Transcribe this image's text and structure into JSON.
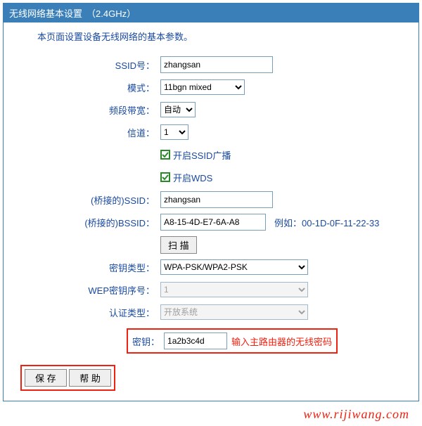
{
  "header": {
    "title": "无线网络基本设置",
    "band": "（2.4GHz）"
  },
  "desc": "本页面设置设备无线网络的基本参数。",
  "labels": {
    "ssid": "SSID号：",
    "mode": "模式：",
    "bw": "频段带宽：",
    "channel": "信道：",
    "enable_ssid_bc": "开启SSID广播",
    "enable_wds": "开启WDS",
    "bridge_ssid": "(桥接的)SSID：",
    "bridge_bssid": "(桥接的)BSSID：",
    "bssid_hint": "例如：00-1D-0F-11-22-33",
    "scan": "扫 描",
    "key_type": "密钥类型：",
    "wep_idx": "WEP密钥序号：",
    "auth_type": "认证类型：",
    "key": "密钥：",
    "key_hint": "输入主路由器的无线密码",
    "save": "保 存",
    "help": "帮 助"
  },
  "values": {
    "ssid": "zhangsan",
    "mode": "11bgn mixed",
    "bw": "自动",
    "channel": "1",
    "bridge_ssid": "zhangsan",
    "bridge_bssid": "A8-15-4D-E7-6A-A8",
    "key_type": "WPA-PSK/WPA2-PSK",
    "wep_idx": "1",
    "auth_type": "开放系统",
    "key": "1a2b3c4d"
  },
  "watermark": "www.rijiwang.com"
}
